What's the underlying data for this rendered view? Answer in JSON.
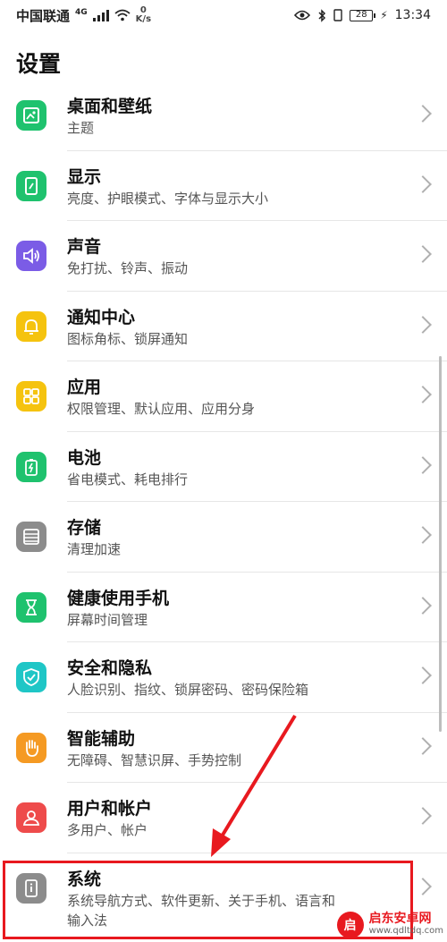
{
  "status_bar": {
    "carrier": "中国联通",
    "network": "4G",
    "speed_value": "0",
    "speed_unit": "K/s",
    "battery": "28",
    "time": "13:34"
  },
  "page_title": "设置",
  "items": [
    {
      "title": "桌面和壁纸",
      "subtitle": "主题",
      "icon": "wallpaper-icon",
      "color": "#1fc26e"
    },
    {
      "title": "显示",
      "subtitle": "亮度、护眼模式、字体与显示大小",
      "icon": "display-icon",
      "color": "#1fc26e"
    },
    {
      "title": "声音",
      "subtitle": "免打扰、铃声、振动",
      "icon": "speaker-icon",
      "color": "#7b5ce6"
    },
    {
      "title": "通知中心",
      "subtitle": "图标角标、锁屏通知",
      "icon": "bell-icon",
      "color": "#f5c30f"
    },
    {
      "title": "应用",
      "subtitle": "权限管理、默认应用、应用分身",
      "icon": "apps-grid-icon",
      "color": "#f5c30f"
    },
    {
      "title": "电池",
      "subtitle": "省电模式、耗电排行",
      "icon": "battery-icon",
      "color": "#1fc26e"
    },
    {
      "title": "存储",
      "subtitle": "清理加速",
      "icon": "storage-icon",
      "color": "#8c8c8c"
    },
    {
      "title": "健康使用手机",
      "subtitle": "屏幕时间管理",
      "icon": "hourglass-icon",
      "color": "#1fc26e"
    },
    {
      "title": "安全和隐私",
      "subtitle": "人脸识别、指纹、锁屏密码、密码保险箱",
      "icon": "shield-icon",
      "color": "#1fc6c6"
    },
    {
      "title": "智能辅助",
      "subtitle": "无障碍、智慧识屏、手势控制",
      "icon": "hand-icon",
      "color": "#f59a23"
    },
    {
      "title": "用户和帐户",
      "subtitle": "多用户、帐户",
      "icon": "user-icon",
      "color": "#ee4b4b"
    },
    {
      "title": "系统",
      "subtitle": "系统导航方式、软件更新、关于手机、语言和",
      "subtitle2": "输入法",
      "icon": "system-info-icon",
      "color": "#8c8c8c"
    }
  ],
  "watermark": {
    "logo": "启",
    "name": "启东安卓网",
    "url": "www.qdltdq.com"
  }
}
